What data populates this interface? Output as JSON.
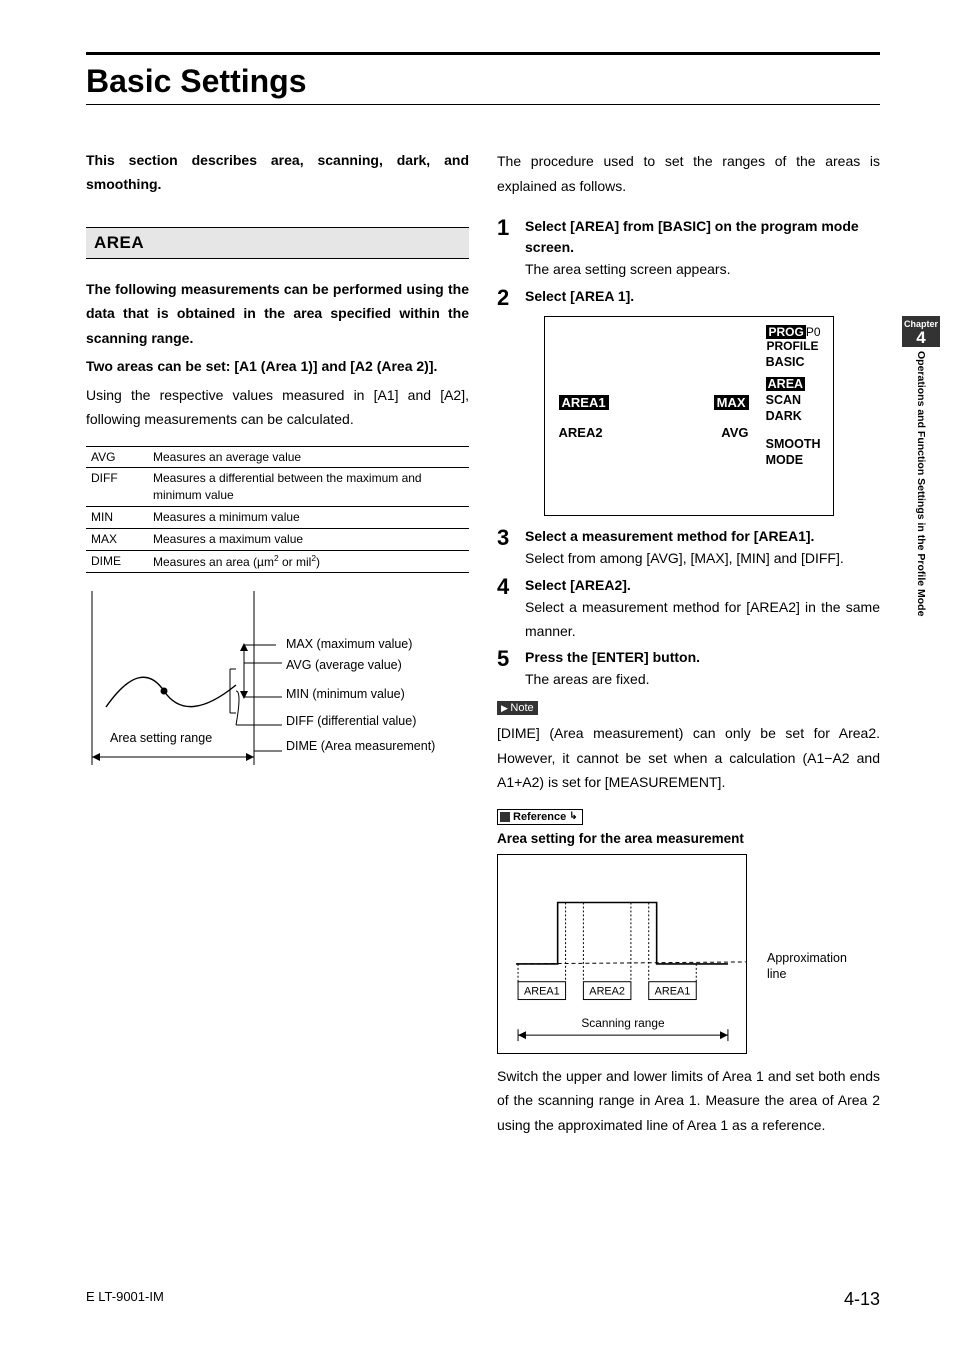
{
  "title": "Basic Settings",
  "intro": "This section describes area, scanning, dark, and smoothing.",
  "area": {
    "heading": "AREA",
    "lead_bold": "The following measurements can be performed using the data that is obtained in the area specified within the scanning range.",
    "lead_bold2": "Two areas can be set: [A1 (Area 1)] and [A2 (Area 2)].",
    "lead_plain": "Using the respective values measured in [A1] and [A2], following measurements can be calculated.",
    "table": [
      {
        "k": "AVG",
        "v": "Measures an average value"
      },
      {
        "k": "DIFF",
        "v": "Measures a differential between the maximum and minimum value"
      },
      {
        "k": "MIN",
        "v": "Measures a minimum value"
      },
      {
        "k": "MAX",
        "v": "Measures a maximum value"
      },
      {
        "k": "DIME",
        "v": "Measures an area (µm² or mil²)"
      }
    ],
    "diagram_labels": {
      "max": "MAX (maximum value)",
      "avg": "AVG (average value)",
      "min": "MIN (minimum value)",
      "diff": "DIFF (differential value)",
      "dime": "DIME (Area measurement)",
      "range": "Area setting range"
    }
  },
  "right": {
    "procedure_intro": "The procedure used to set the ranges of the areas is explained as follows.",
    "steps": [
      {
        "n": "1",
        "title": "Select [AREA] from [BASIC] on the program mode screen.",
        "text": "The area setting screen appears."
      },
      {
        "n": "2",
        "title": "Select [AREA 1].",
        "text": ""
      },
      {
        "n": "3",
        "title": "Select a measurement method for [AREA1].",
        "text": "Select from among [AVG], [MAX], [MIN] and [DIFF]."
      },
      {
        "n": "4",
        "title": "Select [AREA2].",
        "text": "Select a measurement method for [AREA2] in the same manner."
      },
      {
        "n": "5",
        "title": "Press the [ENTER] button.",
        "text": "The areas are fixed."
      }
    ],
    "screen": {
      "prog": "PROG",
      "p0": "P0",
      "profile": "PROFILE",
      "basic": "BASIC",
      "menu": [
        "AREA",
        "SCAN",
        "DARK"
      ],
      "smooth": "SMOOTH",
      "mode": "MODE",
      "row1": {
        "l": "AREA1",
        "r": "MAX"
      },
      "row2": {
        "l": "AREA2",
        "r": "AVG"
      }
    },
    "note_tag": "Note",
    "note_text": "[DIME] (Area measurement) can only be set for Area2. However, it cannot be set when a calculation (A1−A2 and A1+A2) is set for [MEASUREMENT].",
    "ref_tag": "Reference",
    "ref_title": "Area setting for the area measurement",
    "fig2": {
      "area1": "AREA1",
      "area2": "AREA2",
      "area1b": "AREA1",
      "scan": "Scanning range",
      "approx": "Approximation line"
    },
    "ref_text": "Switch the upper and lower limits of Area 1 and set both ends of the scanning range in Area 1. Measure the area of Area 2 using the approximated line of Area 1 as a reference."
  },
  "footer": {
    "doc": "E LT-9001-IM",
    "page": "4-13"
  },
  "side": {
    "chapter_label": "Chapter",
    "chapter": "4",
    "text": "Operations and Function Settings in the Profile Mode"
  }
}
